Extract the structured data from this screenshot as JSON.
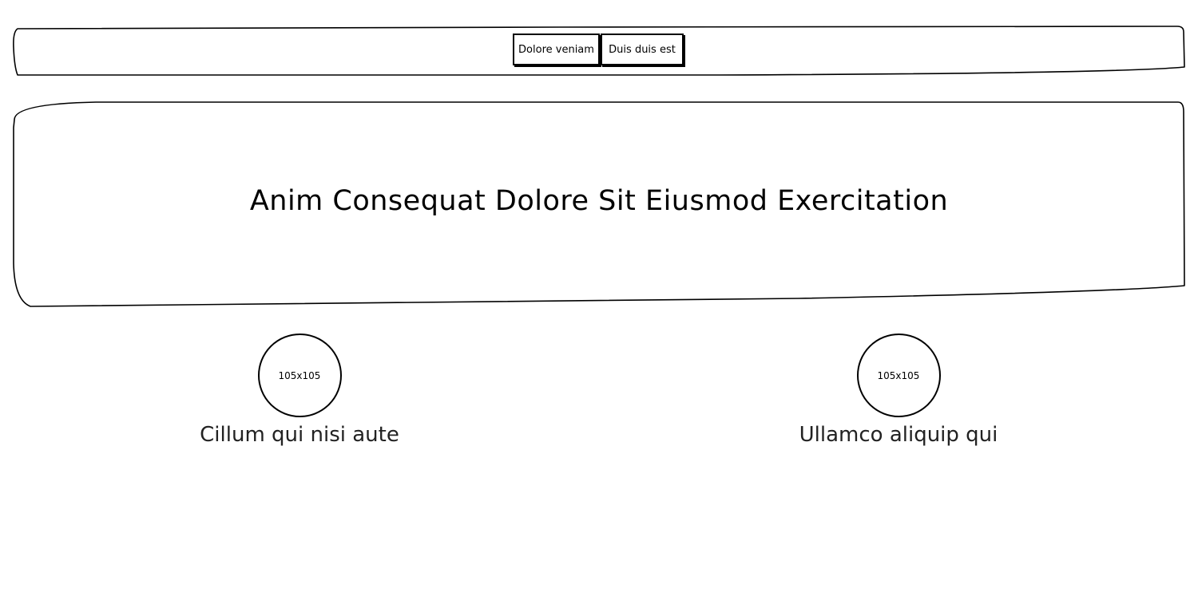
{
  "nav": {
    "buttons": [
      {
        "label": "Dolore veniam"
      },
      {
        "label": "Duis duis est"
      }
    ]
  },
  "hero": {
    "title": "Anim Consequat Dolore Sit Eiusmod Exercitation"
  },
  "features": [
    {
      "placeholder": "105x105",
      "caption": "Cillum qui nisi aute"
    },
    {
      "placeholder": "105x105",
      "caption": "Ullamco aliquip qui"
    }
  ]
}
